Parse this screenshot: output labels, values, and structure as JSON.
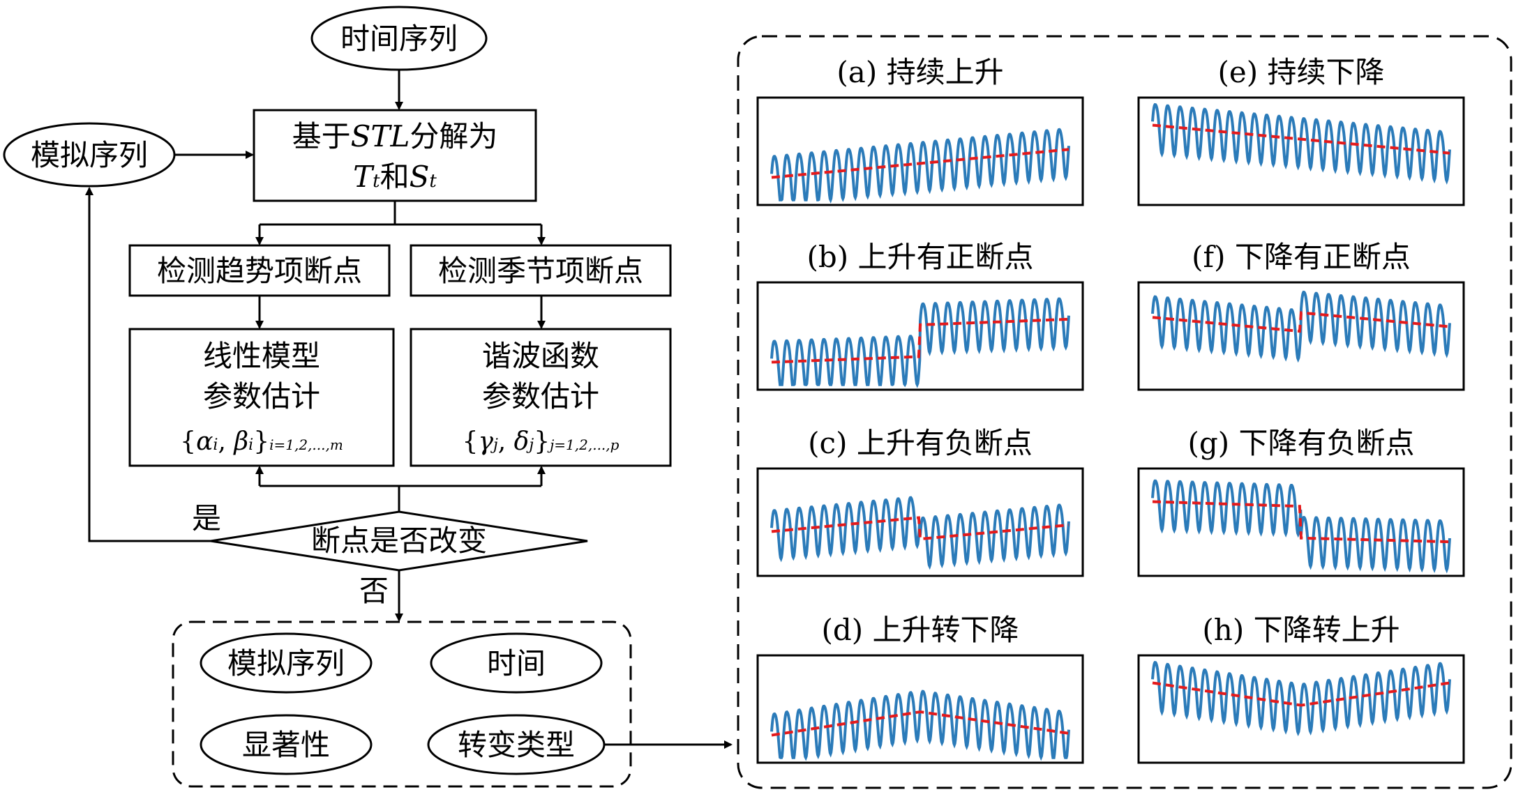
{
  "flow": {
    "time_series": "时间序列",
    "simulated_series": "模拟序列",
    "stl": {
      "line1_pre": "基于",
      "line1_it": "STL",
      "line1_post": "分解为",
      "T": "T",
      "t_sub": "t",
      "and": "和",
      "S": "S",
      "s_sub": "t"
    },
    "detect_trend": "检测趋势项断点",
    "detect_season": "检测季节项断点",
    "linear_model": {
      "line1": "线性模型",
      "line2": "参数估计",
      "formula_open": "{",
      "alpha": "α",
      "alpha_sub": "i",
      "comma": ", ",
      "beta": "β",
      "beta_sub": "i",
      "formula_close": "}",
      "range": "i=1,2,...,m"
    },
    "harmonic": {
      "line1": "谐波函数",
      "line2": "参数估计",
      "formula_open": "{",
      "gamma": "γ",
      "gamma_sub": "j",
      "comma": ", ",
      "delta": "δ",
      "delta_sub": "j",
      "formula_close": "}",
      "range": "j=1,2,...,p"
    },
    "decision": "断点是否改变",
    "yes": "是",
    "no": "否"
  },
  "outputs": {
    "simulated_series": "模拟序列",
    "time": "时间",
    "significance": "显著性",
    "change_type": "转变类型"
  },
  "panels": [
    {
      "label": "(a) 持续上升",
      "trend": "up"
    },
    {
      "label": "(b) 上升有正断点",
      "trend": "up_pos_break"
    },
    {
      "label": "(c) 上升有负断点",
      "trend": "up_neg_break"
    },
    {
      "label": "(d) 上升转下降",
      "trend": "up_then_down"
    },
    {
      "label": "(e) 持续下降",
      "trend": "down"
    },
    {
      "label": "(f) 下降有正断点",
      "trend": "down_pos_break"
    },
    {
      "label": "(g) 下降有负断点",
      "trend": "down_neg_break"
    },
    {
      "label": "(h) 下降转上升",
      "trend": "down_then_up"
    }
  ],
  "colors": {
    "series": "#2b7bb9",
    "trend": "#e41a1c",
    "line": "#000000"
  }
}
